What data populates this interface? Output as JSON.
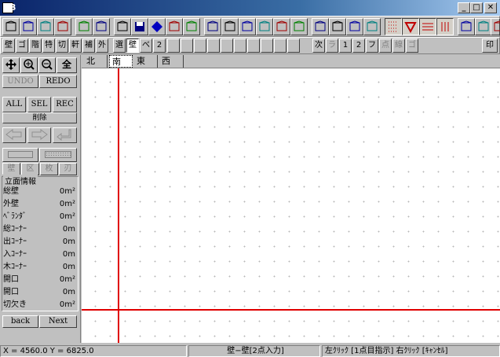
{
  "window": {
    "title": "B",
    "minimize": "_",
    "maximize": "□",
    "close": "✕"
  },
  "icon_toolbar": {
    "icons": [
      "camera-house-icon",
      "house-plan-icon",
      "house-elevation-icon",
      "house-roof-icon",
      "wall-pattern-icon",
      "pen-edit-icon",
      "new-document-icon",
      "save-disk-icon",
      "diamond-icon",
      "copy-document-icon",
      "window-layout-icon",
      "grid-table-icon",
      "grid-window-icon",
      "columns-icon",
      "column-split-icon",
      "cross-icon",
      "angle-icon",
      "box-icon",
      "pencil-icon",
      "door-arch-icon",
      "binoculars-icon",
      "dotted-grid-icon",
      "triangle-marker-icon",
      "horizontal-hatch-icon",
      "vertical-bars-icon",
      "arc-icon",
      "print-preview-icon",
      "house-outline-icon"
    ]
  },
  "mode_toolbar": {
    "left": [
      "壁",
      "ゴ",
      "階",
      "特",
      "切",
      "軒",
      "補",
      "外",
      "選",
      "壁",
      "べ",
      "2"
    ],
    "right": [
      "次",
      "ラ",
      "1",
      "2",
      "フ",
      "点",
      "線",
      "ゴ"
    ],
    "print": "印"
  },
  "left_panel": {
    "undo": "UNDO",
    "redo": "REDO",
    "all": "ALL",
    "sel": "SEL",
    "rec": "REC",
    "delete": "削除",
    "four": [
      "壁",
      "区",
      "枚",
      "刃"
    ],
    "info_title": "立面情報",
    "info_rows": [
      {
        "label": "総壁",
        "value": "0m²"
      },
      {
        "label": "外壁",
        "value": "0m²"
      },
      {
        "label": "ﾍﾞﾗﾝﾀﾞ",
        "value": "0m²"
      },
      {
        "label": "総ｺｰﾅｰ",
        "value": "0m"
      },
      {
        "label": "出ｺｰﾅｰ",
        "value": "0m"
      },
      {
        "label": "入ｺｰﾅｰ",
        "value": "0m"
      },
      {
        "label": "木ｺｰﾅｰ",
        "value": "0m"
      },
      {
        "label": "開口",
        "value": "0m²"
      },
      {
        "label": "開口",
        "value": "0m"
      },
      {
        "label": "切欠き",
        "value": "0m²"
      }
    ],
    "back": "back",
    "next": "Next"
  },
  "tabs": [
    "北",
    "南",
    "東",
    "西"
  ],
  "active_tab": "南",
  "status": {
    "coords": "X = 4560.0 Y = 6825.0",
    "mode": "壁−壁[2点入力]",
    "hint": "左ｸﾘｯｸ [1点目指示]  右ｸﾘｯｸ [ｷｬﾝｾﾙ]"
  },
  "colors": {
    "titlebar": "#0a246a",
    "guide_line": "#e00000",
    "face": "#c0c0c0"
  }
}
